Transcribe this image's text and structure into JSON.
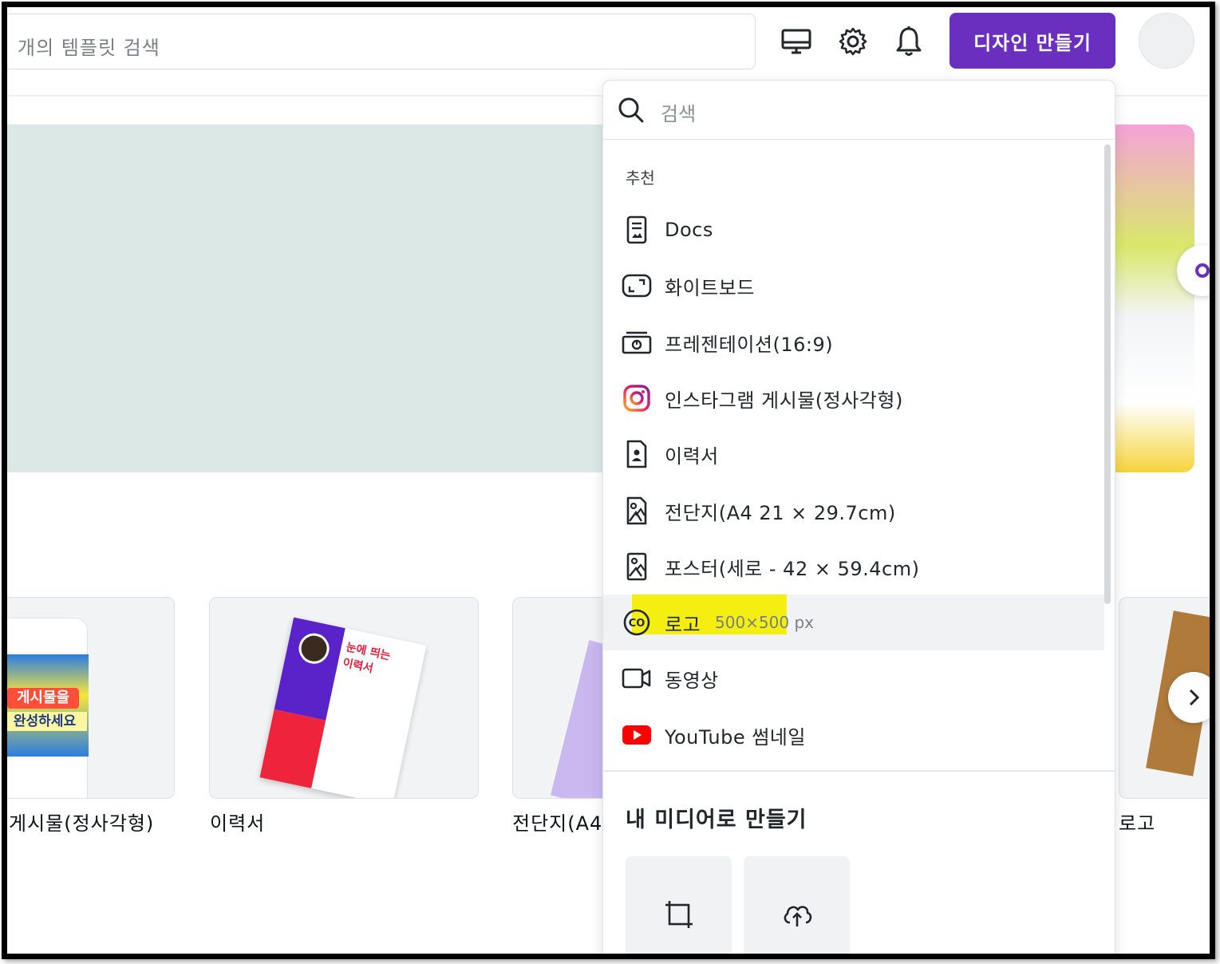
{
  "header": {
    "search_placeholder": "개의 템플릿 검색",
    "create_button": "디자인 만들기"
  },
  "colors": {
    "accent": "#6a2fbf",
    "highlight": "#f4ef10",
    "youtube": "#ff0000"
  },
  "dropdown": {
    "search_placeholder": "검색",
    "section_recommended": "추천",
    "items": [
      {
        "label": "Docs",
        "icon": "docs-icon"
      },
      {
        "label": "화이트보드",
        "icon": "whiteboard-icon"
      },
      {
        "label": "프레젠테이션(16:9)",
        "icon": "presentation-icon"
      },
      {
        "label": "인스타그램 게시물(정사각형)",
        "icon": "instagram-icon"
      },
      {
        "label": "이력서",
        "icon": "resume-icon"
      },
      {
        "label": "전단지(A4 21 × 29.7cm)",
        "icon": "flyer-icon"
      },
      {
        "label": "포스터(세로 - 42 × 59.4cm)",
        "icon": "poster-icon"
      },
      {
        "label": "로고",
        "sublabel": "500×500 px",
        "icon": "logo-icon",
        "highlighted": true
      },
      {
        "label": "동영상",
        "icon": "video-icon"
      },
      {
        "label": "YouTube 썸네일",
        "icon": "youtube-icon"
      }
    ],
    "section_media": "내 미디어로 만들기",
    "media_tiles": [
      {
        "icon": "custom-size-icon"
      },
      {
        "icon": "upload-cloud-icon"
      }
    ]
  },
  "cards": [
    {
      "label": "게시물(정사각형)",
      "image_text_1": "게시물을",
      "image_text_2": "완성하세요"
    },
    {
      "label": "이력서",
      "image_text_1": "눈에 띄는",
      "image_text_2": "이력서"
    },
    {
      "label": "전단지(A4"
    },
    {
      "label": "로고"
    }
  ]
}
